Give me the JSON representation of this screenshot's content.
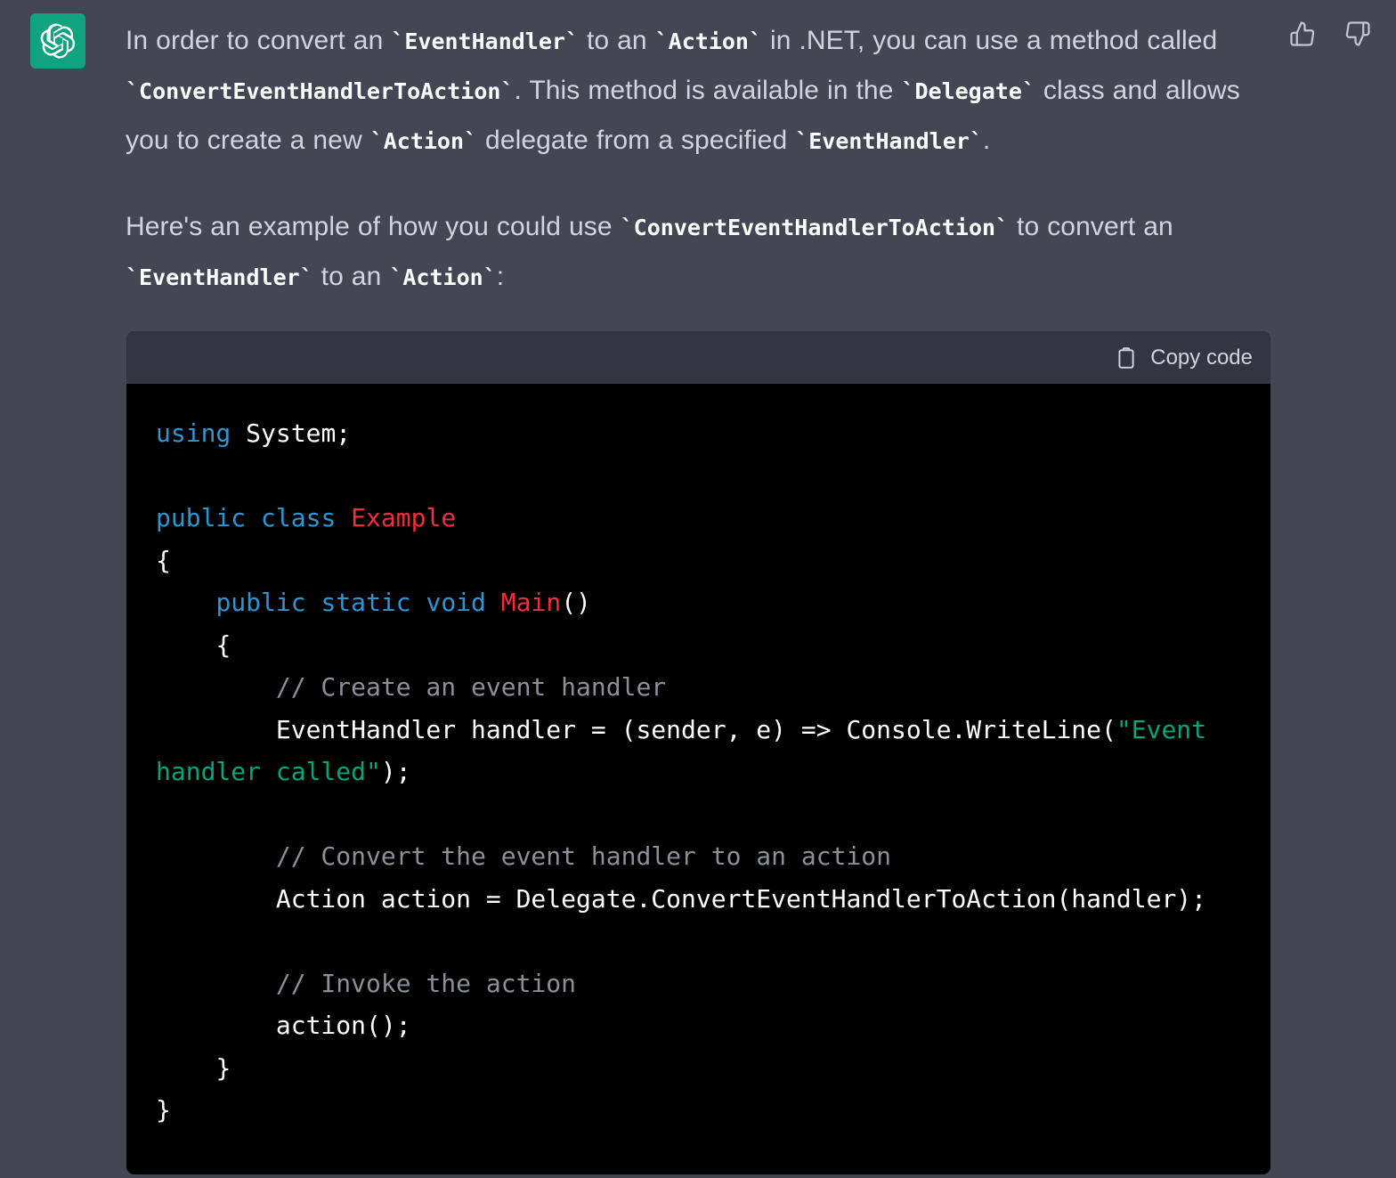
{
  "theme": {
    "page_bg": "#444654",
    "avatar_bg": "#10a37f",
    "code_header_bg": "#343541",
    "code_bg": "#000000",
    "text": "#d1d5db",
    "keyword": "#2e95d3",
    "class_name": "#f22c3d",
    "string": "#00a67d",
    "comment": "#8a8f98"
  },
  "avatar": {
    "name": "chatgpt-logo"
  },
  "feedback": {
    "thumbs_up_label": "thumbs-up",
    "thumbs_down_label": "thumbs-down"
  },
  "message": {
    "paragraph1": {
      "s1": "In order to convert an ",
      "c1": "`EventHandler`",
      "s2": " to an ",
      "c2": "`Action`",
      "s3": " in .NET, you can use a method called ",
      "c3": "`ConvertEventHandlerToAction`",
      "s4": ". This method is available in the ",
      "c4": "`Delegate`",
      "s5": " class and allows you to create a new ",
      "c5": "`Action`",
      "s6": " delegate from a specified ",
      "c6": "`EventHandler`",
      "s7": "."
    },
    "paragraph2": {
      "s1": "Here's an example of how you could use ",
      "c1": "`ConvertEventHandlerToAction`",
      "s2": " to convert an ",
      "c2": "`EventHandler`",
      "s3": " to an ",
      "c3": "`Action`",
      "s4": ":"
    }
  },
  "code_block": {
    "copy_label": "Copy code",
    "copy_icon": "clipboard-icon",
    "language": "csharp",
    "lines": [
      {
        "id": "l1",
        "tokens": [
          {
            "t": "using",
            "c": "kw"
          },
          {
            "t": " System;",
            "c": "pln"
          }
        ]
      },
      {
        "id": "l2",
        "tokens": []
      },
      {
        "id": "l3",
        "tokens": [
          {
            "t": "public",
            "c": "kw"
          },
          {
            "t": " ",
            "c": "pln"
          },
          {
            "t": "class",
            "c": "kw"
          },
          {
            "t": " ",
            "c": "pln"
          },
          {
            "t": "Example",
            "c": "cls"
          }
        ]
      },
      {
        "id": "l4",
        "tokens": [
          {
            "t": "{",
            "c": "pln"
          }
        ]
      },
      {
        "id": "l5",
        "tokens": [
          {
            "t": "    ",
            "c": "pln"
          },
          {
            "t": "public",
            "c": "kw"
          },
          {
            "t": " ",
            "c": "pln"
          },
          {
            "t": "static",
            "c": "kw"
          },
          {
            "t": " ",
            "c": "pln"
          },
          {
            "t": "void",
            "c": "kw"
          },
          {
            "t": " ",
            "c": "pln"
          },
          {
            "t": "Main",
            "c": "cls"
          },
          {
            "t": "()",
            "c": "pln"
          }
        ]
      },
      {
        "id": "l6",
        "tokens": [
          {
            "t": "    {",
            "c": "pln"
          }
        ]
      },
      {
        "id": "l7",
        "tokens": [
          {
            "t": "        ",
            "c": "pln"
          },
          {
            "t": "// Create an event handler",
            "c": "cmt"
          }
        ]
      },
      {
        "id": "l8",
        "tokens": [
          {
            "t": "        EventHandler handler = (sender, e) => Console.WriteLine(",
            "c": "pln"
          },
          {
            "t": "\"Event handler called\"",
            "c": "str"
          },
          {
            "t": ");",
            "c": "pln"
          }
        ]
      },
      {
        "id": "l9",
        "tokens": []
      },
      {
        "id": "l10",
        "tokens": [
          {
            "t": "        ",
            "c": "pln"
          },
          {
            "t": "// Convert the event handler to an action",
            "c": "cmt"
          }
        ]
      },
      {
        "id": "l11",
        "tokens": [
          {
            "t": "        Action action = Delegate.ConvertEventHandlerToAction(handler);",
            "c": "pln"
          }
        ]
      },
      {
        "id": "l12",
        "tokens": []
      },
      {
        "id": "l13",
        "tokens": [
          {
            "t": "        ",
            "c": "pln"
          },
          {
            "t": "// Invoke the action",
            "c": "cmt"
          }
        ]
      },
      {
        "id": "l14",
        "tokens": [
          {
            "t": "        action();",
            "c": "pln"
          }
        ]
      },
      {
        "id": "l15",
        "tokens": [
          {
            "t": "    }",
            "c": "pln"
          }
        ]
      },
      {
        "id": "l16",
        "tokens": [
          {
            "t": "}",
            "c": "pln"
          }
        ]
      }
    ]
  }
}
